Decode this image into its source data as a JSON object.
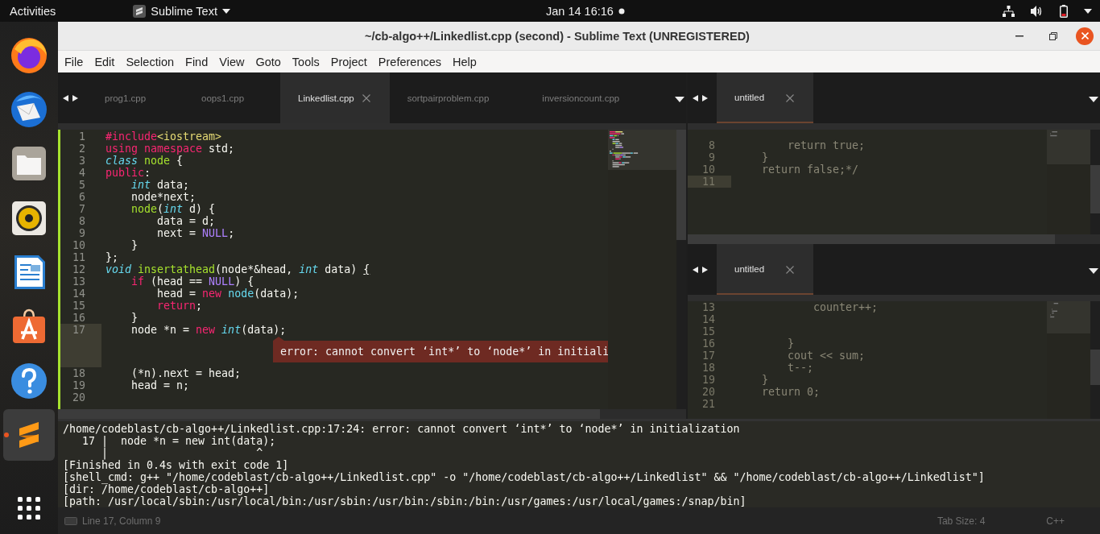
{
  "top_bar": {
    "activities": "Activities",
    "app_menu": "Sublime Text",
    "clock": "Jan 14  16:16"
  },
  "dock": {
    "items": [
      {
        "kind": "browser",
        "running": false,
        "selected": false
      },
      {
        "kind": "mail",
        "running": false,
        "selected": false
      },
      {
        "kind": "files",
        "running": false,
        "selected": false
      },
      {
        "kind": "music",
        "running": false,
        "selected": false
      },
      {
        "kind": "writer",
        "running": false,
        "selected": false
      },
      {
        "kind": "store",
        "running": false,
        "selected": false
      },
      {
        "kind": "help",
        "running": false,
        "selected": false
      },
      {
        "kind": "editor",
        "running": true,
        "selected": true
      },
      {
        "kind": "apps",
        "running": false,
        "selected": false
      }
    ]
  },
  "window": {
    "title": "~/cb-algo++/Linkedlist.cpp (second) - Sublime Text (UNREGISTERED)"
  },
  "menu": [
    "File",
    "Edit",
    "Selection",
    "Find",
    "View",
    "Goto",
    "Tools",
    "Project",
    "Preferences",
    "Help"
  ],
  "editor_groups": [
    {
      "focused": true,
      "tabs": [
        {
          "label": "prog1.cpp",
          "selected": false
        },
        {
          "label": "oops1.cpp",
          "selected": false
        },
        {
          "label": "Linkedlist.cpp",
          "selected": true
        },
        {
          "label": "sortpairproblem.cpp",
          "selected": false
        },
        {
          "label": "inversioncount.cpp",
          "selected": false
        }
      ],
      "lines": [
        {
          "number": "1",
          "current": false,
          "tokens": [
            {
              "kind": "keyword",
              "text": "#include"
            },
            {
              "kind": "string",
              "text": "<iostream>"
            }
          ]
        },
        {
          "number": "2",
          "current": false,
          "tokens": [
            {
              "kind": "keyword",
              "text": "using namespace"
            },
            {
              "kind": "plain",
              "text": " std;"
            }
          ]
        },
        {
          "number": "3",
          "current": false,
          "tokens": [
            {
              "kind": "type",
              "text": "class"
            },
            {
              "kind": "name",
              "text": " node"
            },
            {
              "kind": "plain",
              "text": " {"
            }
          ]
        },
        {
          "number": "4",
          "current": false,
          "tokens": [
            {
              "kind": "keyword",
              "text": "public"
            },
            {
              "kind": "plain",
              "text": ":"
            }
          ]
        },
        {
          "number": "5",
          "current": false,
          "tokens": [
            {
              "kind": "type",
              "text": "    int"
            },
            {
              "kind": "plain",
              "text": " data;"
            }
          ]
        },
        {
          "number": "6",
          "current": false,
          "tokens": [
            {
              "kind": "plain",
              "text": "    node*next;"
            }
          ]
        },
        {
          "number": "7",
          "current": false,
          "tokens": [
            {
              "kind": "name",
              "text": "    node"
            },
            {
              "kind": "plain",
              "text": "("
            },
            {
              "kind": "type",
              "text": "int"
            },
            {
              "kind": "plain",
              "text": " d) {"
            }
          ]
        },
        {
          "number": "8",
          "current": false,
          "tokens": [
            {
              "kind": "plain",
              "text": "        data = d;"
            }
          ]
        },
        {
          "number": "9",
          "current": false,
          "tokens": [
            {
              "kind": "plain",
              "text": "        next = "
            },
            {
              "kind": "constant",
              "text": "NULL"
            },
            {
              "kind": "plain",
              "text": ";"
            }
          ]
        },
        {
          "number": "10",
          "current": false,
          "tokens": [
            {
              "kind": "plain",
              "text": "    }"
            }
          ]
        },
        {
          "number": "11",
          "current": false,
          "tokens": [
            {
              "kind": "plain",
              "text": "};"
            }
          ]
        },
        {
          "number": "12",
          "current": false,
          "tokens": [
            {
              "kind": "type",
              "text": "void"
            },
            {
              "kind": "name",
              "text": " insertathead"
            },
            {
              "kind": "plain",
              "text": "(node*&head, "
            },
            {
              "kind": "type",
              "text": "int"
            },
            {
              "kind": "plain",
              "text": " data) "
            },
            {
              "kind": "bracket",
              "text": "{"
            }
          ]
        },
        {
          "number": "13",
          "current": false,
          "tokens": [
            {
              "kind": "keyword",
              "text": "    if"
            },
            {
              "kind": "plain",
              "text": " (head == "
            },
            {
              "kind": "constant",
              "text": "NULL"
            },
            {
              "kind": "plain",
              "text": ") {"
            }
          ]
        },
        {
          "number": "14",
          "current": false,
          "tokens": [
            {
              "kind": "plain",
              "text": "        head = "
            },
            {
              "kind": "keyword",
              "text": "new"
            },
            {
              "kind": "support",
              "text": " node"
            },
            {
              "kind": "plain",
              "text": "(data);"
            }
          ]
        },
        {
          "number": "15",
          "current": false,
          "tokens": [
            {
              "kind": "keyword",
              "text": "        return"
            },
            {
              "kind": "plain",
              "text": ";"
            }
          ]
        },
        {
          "number": "16",
          "current": false,
          "tokens": [
            {
              "kind": "plain",
              "text": "    }"
            }
          ]
        },
        {
          "number": "17",
          "current": true,
          "error": "error: cannot convert ‘int*’ to ‘node*’ in initiali",
          "tokens": [
            {
              "kind": "plain",
              "text": "    node *n = "
            },
            {
              "kind": "keyword",
              "text": "new"
            },
            {
              "kind": "type",
              "text": " int"
            },
            {
              "kind": "plain",
              "text": "(data);"
            }
          ]
        },
        {
          "number": "18",
          "current": false,
          "tokens": [
            {
              "kind": "plain",
              "text": "    (*n).next = head;"
            }
          ]
        },
        {
          "number": "19",
          "current": false,
          "tokens": [
            {
              "kind": "plain",
              "text": "    head = n;"
            }
          ]
        },
        {
          "number": "20",
          "current": false
        }
      ]
    },
    {
      "focused": false,
      "tabs": [
        {
          "label": "untitled",
          "selected": true
        }
      ],
      "lines": [
        {
          "number": "8",
          "current": false,
          "tokens": [
            {
              "kind": "plain",
              "text": "        return true;"
            }
          ]
        },
        {
          "number": "9",
          "current": false,
          "tokens": [
            {
              "kind": "plain",
              "text": "    }"
            }
          ]
        },
        {
          "number": "10",
          "current": false,
          "tokens": [
            {
              "kind": "plain",
              "text": "    return false;*/"
            }
          ]
        },
        {
          "number": "11",
          "current": true
        }
      ]
    },
    {
      "focused": false,
      "tabs": [
        {
          "label": "untitled",
          "selected": true
        }
      ],
      "lines": [
        {
          "number": "13",
          "current": false,
          "tokens": [
            {
              "kind": "plain",
              "text": "            counter++;"
            }
          ]
        },
        {
          "number": "14",
          "current": false
        },
        {
          "number": "15",
          "current": false
        },
        {
          "number": "16",
          "current": false,
          "tokens": [
            {
              "kind": "plain",
              "text": "        }"
            }
          ]
        },
        {
          "number": "17",
          "current": false,
          "tokens": [
            {
              "kind": "plain",
              "text": "        cout << sum;"
            }
          ]
        },
        {
          "number": "18",
          "current": false,
          "tokens": [
            {
              "kind": "plain",
              "text": "        t--;"
            }
          ]
        },
        {
          "number": "19",
          "current": false,
          "tokens": [
            {
              "kind": "plain",
              "text": "    }"
            }
          ]
        },
        {
          "number": "20",
          "current": false,
          "tokens": [
            {
              "kind": "plain",
              "text": "    return 0;"
            }
          ]
        },
        {
          "number": "21",
          "current": false
        }
      ]
    }
  ],
  "console": {
    "lines": [
      "/home/codeblast/cb-algo++/Linkedlist.cpp:17:24: error: cannot convert ‘int*’ to ‘node*’ in initialization",
      "   17 |  node *n = new int(data);",
      "      |                       ^",
      "[Finished in 0.4s with exit code 1]",
      "[shell_cmd: g++ \"/home/codeblast/cb-algo++/Linkedlist.cpp\" -o \"/home/codeblast/cb-algo++/Linkedlist\" && \"/home/codeblast/cb-algo++/Linkedlist\"]",
      "[dir: /home/codeblast/cb-algo++]",
      "[path: /usr/local/sbin:/usr/local/bin:/usr/sbin:/usr/bin:/sbin:/bin:/usr/games:/usr/local/games:/snap/bin]"
    ]
  },
  "status_bar": {
    "position": "Line 17, Column 9",
    "tab_size": "Tab Size: 4",
    "syntax": "C++"
  }
}
